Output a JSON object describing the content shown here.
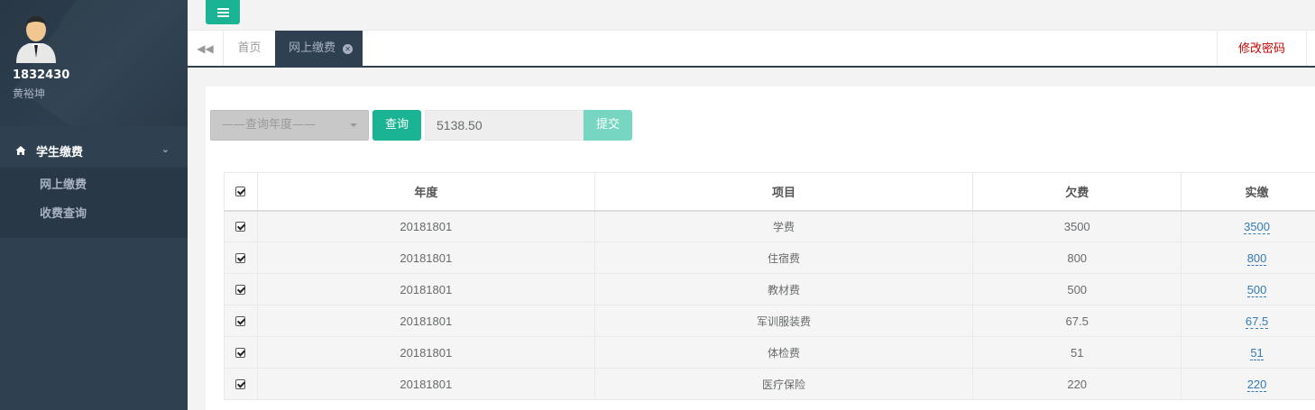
{
  "user": {
    "id": "1832430",
    "name": "黄裕坤"
  },
  "sidebar": {
    "section_label": "学生缴费",
    "items": [
      {
        "label": "网上缴费"
      },
      {
        "label": "收费查询"
      }
    ]
  },
  "tabs": {
    "home_label": "首页",
    "active_label": "网上缴费",
    "change_password_label": "修改密码"
  },
  "form": {
    "year_placeholder": "——查询年度——",
    "query_label": "查询",
    "amount_value": "5138.50",
    "submit_label": "提交"
  },
  "table": {
    "headers": [
      "年度",
      "项目",
      "欠费",
      "实缴"
    ],
    "rows": [
      {
        "year": "20181801",
        "item": "学费",
        "owed": "3500",
        "paid": "3500"
      },
      {
        "year": "20181801",
        "item": "住宿费",
        "owed": "800",
        "paid": "800"
      },
      {
        "year": "20181801",
        "item": "教材费",
        "owed": "500",
        "paid": "500"
      },
      {
        "year": "20181801",
        "item": "军训服装费",
        "owed": "67.5",
        "paid": "67.5"
      },
      {
        "year": "20181801",
        "item": "体检费",
        "owed": "51",
        "paid": "51"
      },
      {
        "year": "20181801",
        "item": "医疗保险",
        "owed": "220",
        "paid": "220"
      }
    ]
  },
  "colors": {
    "sidebar_bg": "#2f4050",
    "accent": "#1ab394",
    "danger_text": "#cc0000",
    "link": "#337ab7"
  }
}
